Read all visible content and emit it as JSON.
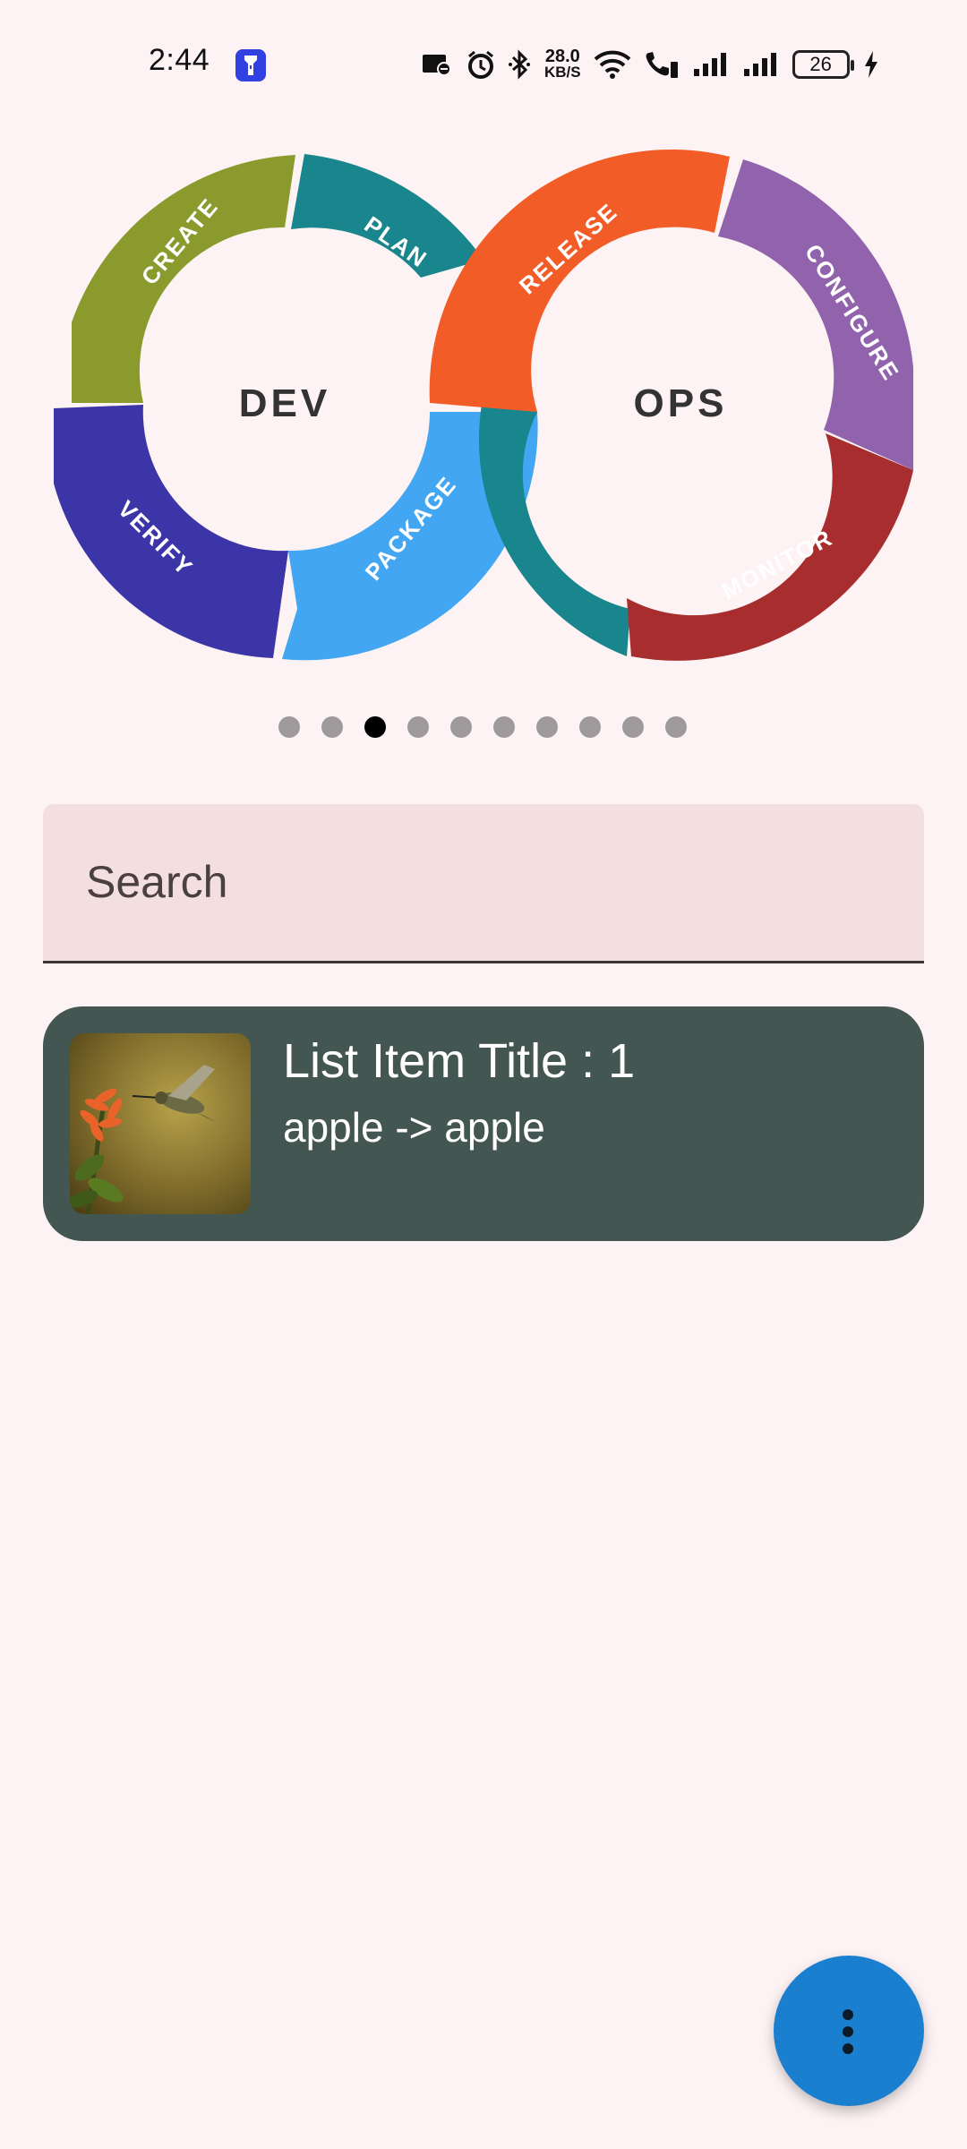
{
  "status_bar": {
    "time": "2:44",
    "network_speed_value": "28.0",
    "network_speed_unit": "KB/S",
    "battery_level": "26",
    "icons": [
      "flashlight-icon",
      "screen-record-icon",
      "alarm-icon",
      "bluetooth-icon",
      "wifi-icon",
      "wifi-calling-icon",
      "signal-icon",
      "signal-icon",
      "battery-icon",
      "charging-icon"
    ]
  },
  "banner": {
    "left_loop_label": "DEV",
    "right_loop_label": "OPS",
    "segments": {
      "create": "CREATE",
      "plan": "PLAN",
      "verify": "VERIFY",
      "package": "PACKAGE",
      "release": "RELEASE",
      "configure": "CONFIGURE",
      "monitor": "MONITOR"
    },
    "colors": {
      "create": "#8a9a2c",
      "plan": "#19858c",
      "verify": "#3b35a8",
      "package": "#42a6f2",
      "release": "#f25c27",
      "configure": "#9163ad",
      "monitor": "#a82d2e",
      "ops_teal": "#19858c"
    }
  },
  "pager": {
    "count": 10,
    "active_index": 2
  },
  "search": {
    "placeholder": "Search"
  },
  "list": {
    "items": [
      {
        "title": "List Item Title : 1",
        "subtitle": "apple -> apple",
        "image": "hummingbird-thumbnail"
      }
    ]
  },
  "fab": {
    "icon": "more-vert-icon"
  },
  "colors": {
    "background": "#fdf3f4",
    "list_item_bg": "#435652",
    "fab": "#1b7fd0",
    "search_bg": "#f3dfe0"
  }
}
